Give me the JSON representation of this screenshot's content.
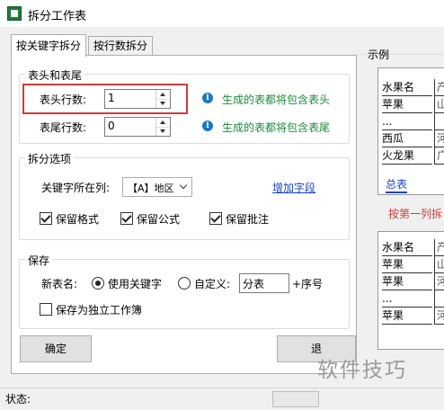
{
  "window": {
    "title": "拆分工作表"
  },
  "tabs": [
    {
      "label": "按关键字拆分",
      "active": true
    },
    {
      "label": "按行数拆分",
      "active": false
    }
  ],
  "header_footer": {
    "group_title": "表头和表尾",
    "header_rows_label": "表头行数:",
    "header_rows_value": "1",
    "header_hint": "生成的表都将包含表头",
    "footer_rows_label": "表尾行数:",
    "footer_rows_value": "0",
    "footer_hint": "生成的表都将包含表尾"
  },
  "split_options": {
    "group_title": "拆分选项",
    "key_column_label": "关键字所在列:",
    "key_column_value": "【A】地区",
    "add_field_link": "增加字段",
    "keep_format": {
      "label": "保留格式",
      "checked": true
    },
    "keep_formula": {
      "label": "保留公式",
      "checked": true
    },
    "keep_comments": {
      "label": "保留批注",
      "checked": true
    }
  },
  "save": {
    "group_title": "保存",
    "new_name_label": "新表名:",
    "use_keyword": {
      "label": "使用关键字",
      "selected": true
    },
    "custom": {
      "label": "自定义:",
      "selected": false
    },
    "custom_value": "分表",
    "suffix_label": "+序号",
    "save_as_workbook": {
      "label": "保存为独立工作簿",
      "checked": false
    }
  },
  "buttons": {
    "confirm": "确定",
    "exit": "退"
  },
  "status": {
    "label": "状态:"
  },
  "example": {
    "title": "示例",
    "sheet1_rows": [
      [
        "水果名",
        "产"
      ],
      [
        "苹果",
        "山"
      ],
      [
        "...",
        ""
      ],
      [
        "西瓜",
        "河"
      ],
      [
        "火龙果",
        "广"
      ]
    ],
    "sheet1_tab": "总表",
    "caption": "按第一列拆",
    "sheet2_rows": [
      [
        "水果名",
        "产"
      ],
      [
        "苹果",
        "山"
      ],
      [
        "苹果",
        "河"
      ],
      [
        "...",
        ""
      ],
      [
        "苹果",
        "河"
      ]
    ]
  },
  "watermark": "软件技巧",
  "colors": {
    "hint": "#1d8a3a",
    "highlight_box": "#d23b3b",
    "link": "#1a45c8",
    "info_icon": "#1a78c2"
  }
}
